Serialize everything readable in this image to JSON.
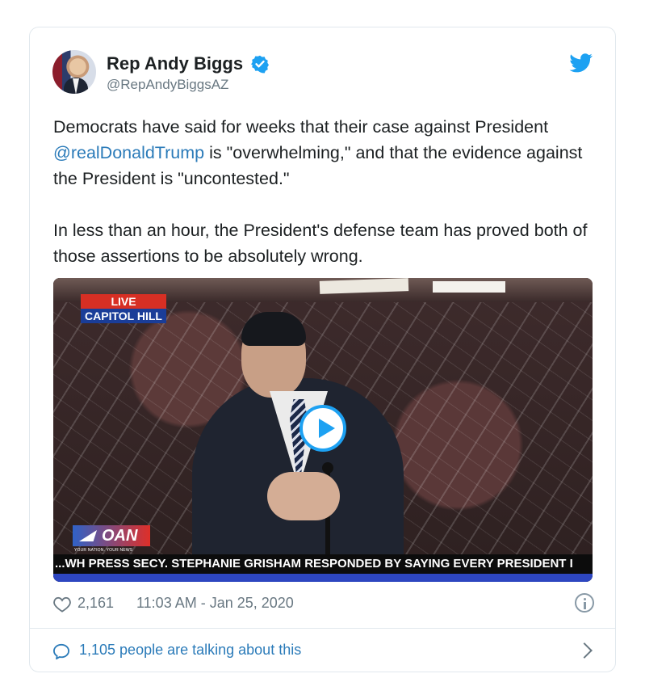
{
  "tweet": {
    "author_name": "Rep Andy Biggs",
    "author_handle": "@RepAndyBiggsAZ",
    "text_1_before_mention": "Democrats have said for weeks that their case against President ",
    "mention": "@realDonaldTrump",
    "text_1_after_mention": " is \"overwhelming,\" and that the evidence against the President is \"uncontested.\"",
    "text_2": "In less than an hour, the President's defense team has proved both of those assertions to be absolutely wrong.",
    "likes": "2,161",
    "timestamp": "11:03 AM - Jan 25, 2020",
    "talking": "1,105 people are talking about this"
  },
  "media": {
    "badge_top": "LIVE",
    "badge_bottom": "CAPITOL HILL",
    "network": "OAN",
    "network_sub": "YOUR NATION. YOUR NEWS",
    "ticker": "...WH PRESS SECY. STEPHANIE GRISHAM RESPONDED BY SAYING EVERY PRESIDENT I"
  },
  "icons": {
    "verified": "verified-icon",
    "bird": "twitter-bird-icon",
    "heart": "heart-icon",
    "info": "info-icon",
    "comment": "comment-icon",
    "chevron": "chevron-right-icon",
    "play": "play-icon"
  },
  "colors": {
    "link": "#2b7bb9",
    "twitter_blue": "#1da1f2",
    "secondary_text": "#697882"
  }
}
